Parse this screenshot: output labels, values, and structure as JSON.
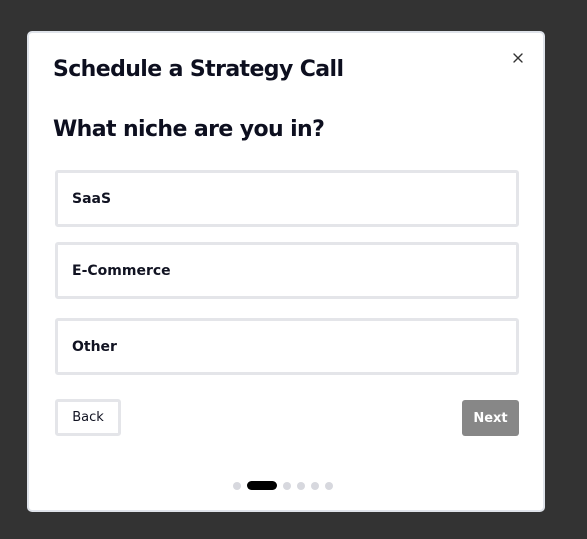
{
  "modal": {
    "title": "Schedule a Strategy Call",
    "close_label": "×"
  },
  "step": {
    "question": "What niche are you in?",
    "options": [
      {
        "label": "SaaS"
      },
      {
        "label": "E-Commerce"
      },
      {
        "label": "Other"
      }
    ]
  },
  "navigation": {
    "back_label": "Back",
    "next_label": "Next"
  },
  "progress": {
    "total_steps": 6,
    "current_step": 2
  },
  "colors": {
    "backdrop": "#333333",
    "modal_bg": "#ffffff",
    "text": "#0d0f1f",
    "option_border": "#e4e5e9",
    "next_disabled": "#878787",
    "progress_active": "#000000",
    "progress_inactive": "#d7d8de"
  },
  "icons": {
    "close": "close-icon"
  }
}
